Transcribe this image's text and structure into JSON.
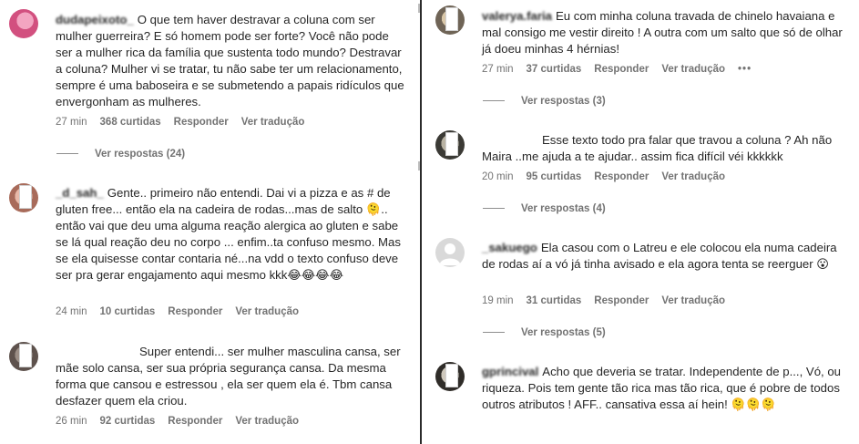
{
  "left": [
    {
      "username": "dudapeixoto_",
      "text": "O que tem haver destravar a coluna com ser mulher guerreira? E só homem pode ser forte? Você não pode ser a mulher rica da família que sustenta todo mundo? Destravar a coluna? Mulher vi se tratar, tu não sabe ter um relacionamento, sempre é uma baboseira e se submetendo a papais ridículos que envergonham as mulheres.",
      "time": "27 min",
      "likes": "368 curtidas",
      "reply": "Responder",
      "translate": "Ver tradução",
      "replies": "Ver respostas (24)"
    },
    {
      "username": "_d_sah_",
      "text": "Gente.. primeiro não entendi. Dai vi a pizza e as # de gluten free... então ela na cadeira de rodas...mas de salto 🫠.. então vai que deu uma alguma reação alergica ao gluten e sabe se lá qual reação deu no corpo ... enfim..ta confuso mesmo. Mas se ela quisesse contar contaria né...na vdd o texto confuso deve ser pra gerar engajamento aqui mesmo kkk😂😂😂😂",
      "time": "24 min",
      "likes": "10 curtidas",
      "reply": "Responder",
      "translate": "Ver tradução"
    },
    {
      "username": "",
      "text": "Super entendi... ser mulher masculina cansa, ser mãe solo cansa, ser sua própria segurança cansa. Da mesma forma que cansou e estressou , ela ser quem ela é. Tbm cansa desfazer quem ela criou.",
      "time": "26 min",
      "likes": "92 curtidas",
      "reply": "Responder",
      "translate": "Ver tradução"
    }
  ],
  "right": [
    {
      "username": "valerya.faria",
      "text": "Eu com minha coluna travada de chinelo havaiana e mal consigo me vestir direito ! A outra com um salto que só de olhar já doeu minhas 4 hérnias!",
      "time": "27 min",
      "likes": "37 curtidas",
      "reply": "Responder",
      "translate": "Ver tradução",
      "more": "•••",
      "replies": "Ver respostas (3)"
    },
    {
      "username": "",
      "text": "Esse texto todo pra falar que travou a coluna ? Ah não Maira ..me ajuda a te ajudar.. assim fica difícil véi kkkkkk",
      "time": "20 min",
      "likes": "95 curtidas",
      "reply": "Responder",
      "translate": "Ver tradução",
      "replies": "Ver respostas (4)"
    },
    {
      "username": "_sakuego",
      "text": "Ela casou com o Latreu e ele colocou ela numa cadeira de rodas aí a vó já tinha avisado e ela agora tenta se reerguer 😮",
      "time": "19 min",
      "likes": "31 curtidas",
      "reply": "Responder",
      "translate": "Ver tradução",
      "replies": "Ver respostas (5)"
    },
    {
      "username": "gprincival",
      "text": "Acho que deveria se tratar. Independente de p..., Vó, ou riqueza. Pois tem gente tão rica mas tão rica, que é pobre de todos outros atributos ! AFF.. cansativa essa aí hein! 🫠🫠🫠"
    }
  ],
  "colors": {
    "text": "#262626",
    "meta": "#737373",
    "divider": "#2b2b2b"
  }
}
